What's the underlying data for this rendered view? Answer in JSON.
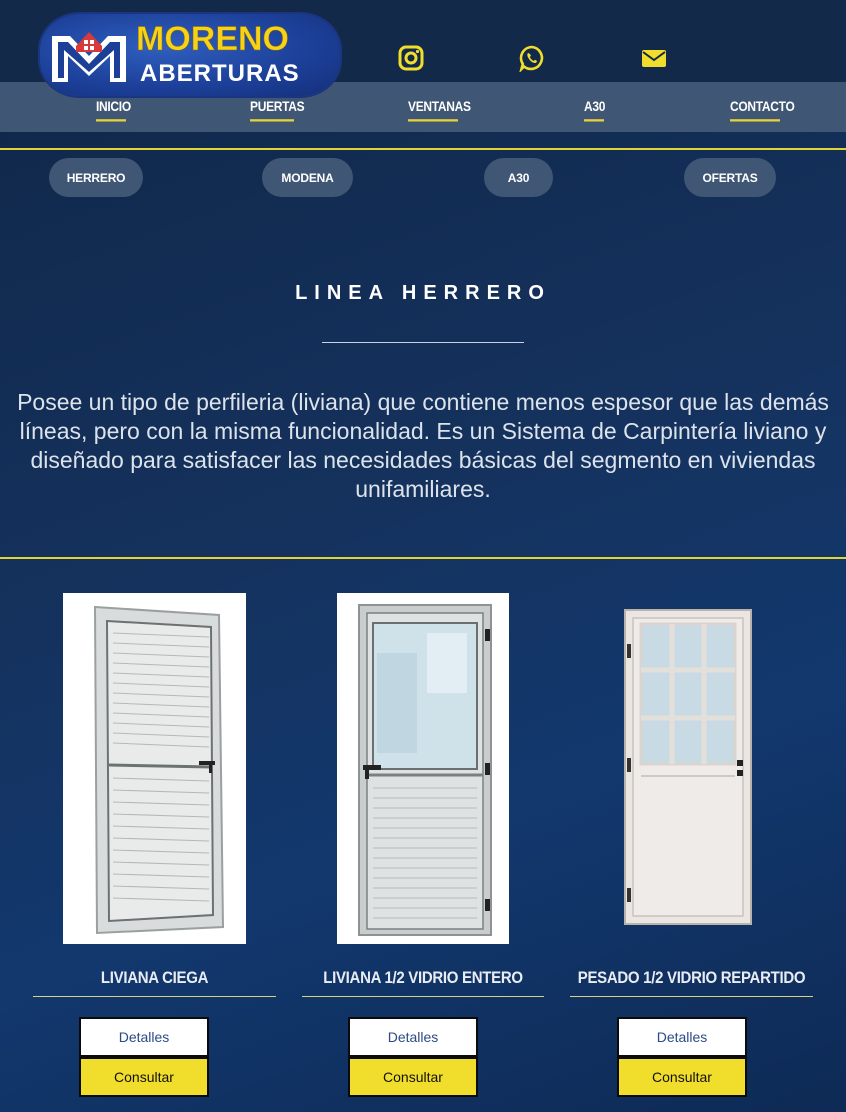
{
  "brand": {
    "name_top": "MORENO",
    "name_bottom": "ABERTURAS",
    "colors": {
      "yellow": "#f6d21a",
      "blue": "#1c3f98",
      "accent_line": "#e1d534"
    }
  },
  "social": [
    {
      "icon": "instagram-icon"
    },
    {
      "icon": "whatsapp-icon"
    },
    {
      "icon": "email-icon"
    }
  ],
  "nav": {
    "items": [
      "INICIO",
      "PUERTAS",
      "VENTANAS",
      "A30",
      "CONTACTO"
    ]
  },
  "subnav": {
    "items": [
      "HERRERO",
      "MODENA",
      "A30",
      "OFERTAS"
    ]
  },
  "section": {
    "title": "LINEA HERRERO",
    "description": "Posee un tipo de perfileria (liviana) que contiene menos espesor que las demás líneas, pero con la misma funcionalidad. Es un Sistema de Carpintería liviano y diseñado para satisfacer las necesidades básicas del segmento en viviendas unifamiliares."
  },
  "products": [
    {
      "name": "LIVIANA CIEGA",
      "details_label": "Detalles",
      "consult_label": "Consultar"
    },
    {
      "name": "LIVIANA 1/2 VIDRIO ENTERO",
      "details_label": "Detalles",
      "consult_label": "Consultar"
    },
    {
      "name": "PESADO 1/2 VIDRIO REPARTIDO",
      "details_label": "Detalles",
      "consult_label": "Consultar"
    }
  ]
}
